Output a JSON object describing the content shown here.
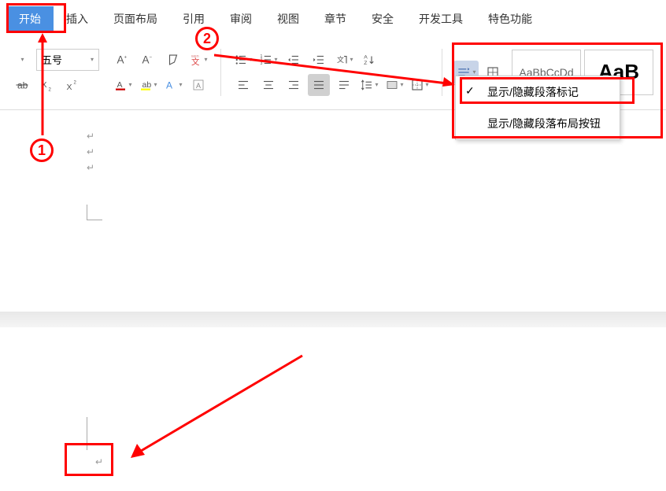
{
  "menu": {
    "start": "开始",
    "insert": "插入",
    "pageLayout": "页面布局",
    "reference": "引用",
    "review": "审阅",
    "view": "视图",
    "chapter": "章节",
    "security": "安全",
    "devTools": "开发工具",
    "special": "特色功能"
  },
  "fontSize": "五号",
  "stylePreview": "AaBbCcDd",
  "styleBig": "AaB",
  "dropdown": {
    "item1": "显示/隐藏段落标记",
    "item2": "显示/隐藏段落布局按钮"
  },
  "paraMark": "↵",
  "anno": {
    "num1": "1",
    "num2": "2"
  }
}
